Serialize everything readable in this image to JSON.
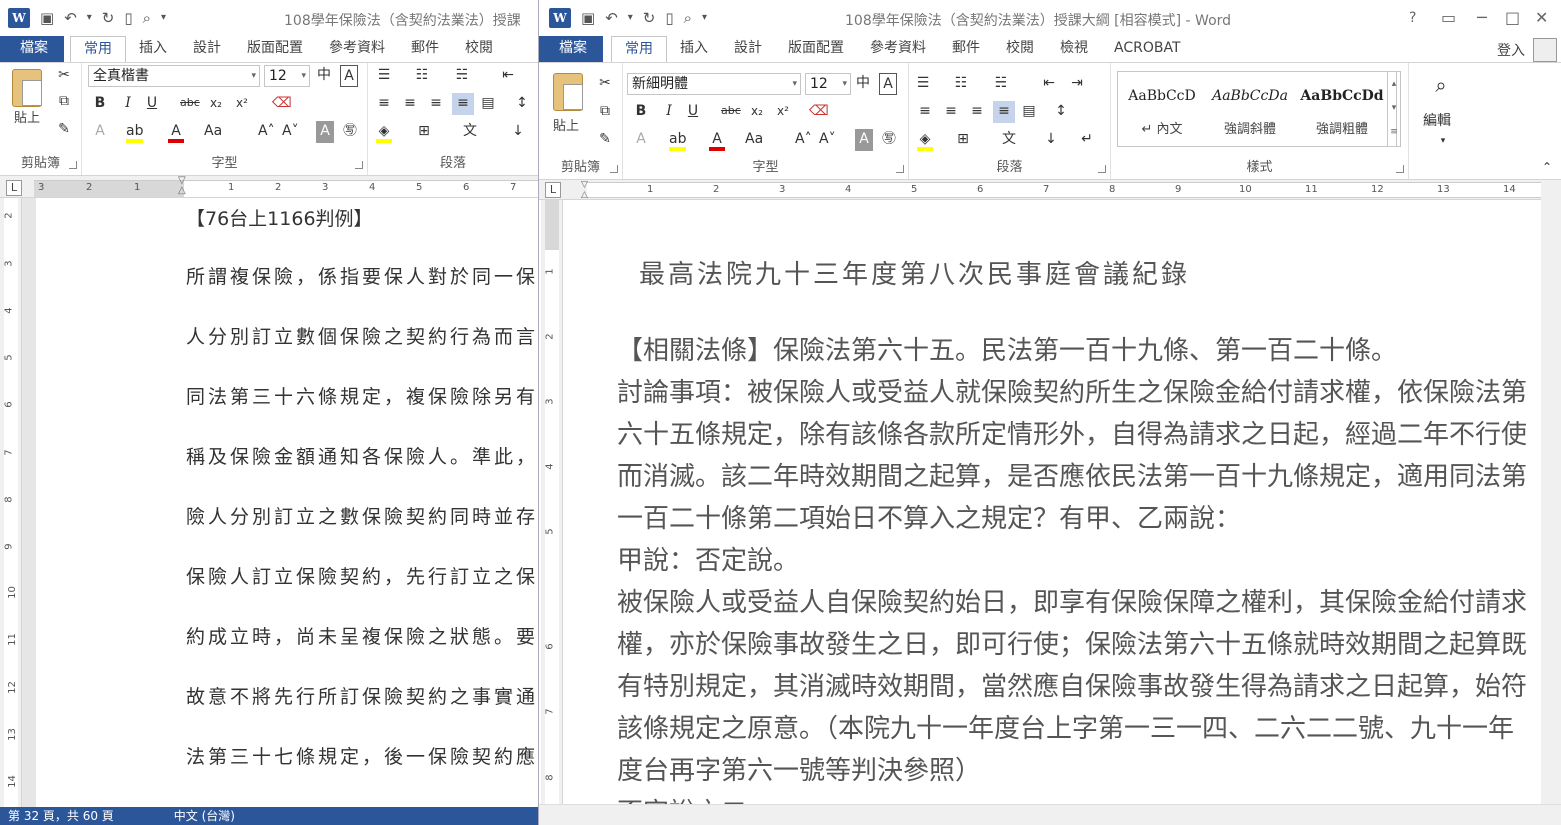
{
  "left_window": {
    "title": "108學年保險法（含契約法業法）授課",
    "tabs": [
      "檔案",
      "常用",
      "插入",
      "設計",
      "版面配置",
      "參考資料",
      "郵件",
      "校閱"
    ],
    "font_name": "全真楷書",
    "font_size": "12",
    "groups": [
      "剪貼簿",
      "字型",
      "段落"
    ],
    "paste_label": "貼上",
    "ruler_numbers": [
      "3",
      "2",
      "1",
      "1",
      "2",
      "3",
      "4",
      "5",
      "6",
      "7"
    ],
    "vruler_numbers": [
      "2",
      "3",
      "4",
      "5",
      "6",
      "7",
      "8",
      "9",
      "10",
      "11",
      "12",
      "13",
      "14"
    ],
    "heading": "【76台上1166判例】",
    "lines": [
      "所謂複保險，係指要保人對於同一保",
      "人分別訂立數個保險之契約行為而言",
      "同法第三十六條規定，複保險除另有",
      "稱及保險金額通知各保險人。準此，",
      "險人分別訂立之數保險契約同時並存",
      "保險人訂立保險契約，先行訂立之保",
      "約成立時，尚未呈複保險之狀態。要",
      "故意不將先行所訂保險契約之事實通",
      "法第三十七條規定，後一保險契約應"
    ],
    "status": "第 32 頁，共 60 頁　　　　　中文 (台灣)"
  },
  "right_window": {
    "title": "108學年保險法（含契約法業法）授課大綱 [相容模式] - Word",
    "help": "?",
    "tabs": [
      "檔案",
      "常用",
      "插入",
      "設計",
      "版面配置",
      "參考資料",
      "郵件",
      "校閱",
      "檢視",
      "ACROBAT"
    ],
    "login": "登入",
    "font_name": "新細明體",
    "font_size": "12",
    "groups": [
      "剪貼簿",
      "字型",
      "段落",
      "樣式"
    ],
    "paste_label": "貼上",
    "styles": [
      {
        "preview": "AaBbCcD",
        "name": "↵ 內文"
      },
      {
        "preview": "AaBbCcDa",
        "name": "強調斜體"
      },
      {
        "preview": "AaBbCcDd",
        "name": "強調粗體"
      }
    ],
    "edit_label": "編輯",
    "ruler_numbers": [
      "1",
      "2",
      "3",
      "4",
      "5",
      "6",
      "7",
      "8",
      "9",
      "10",
      "11",
      "12",
      "13",
      "14"
    ],
    "vruler_numbers": [
      "1",
      "2",
      "3",
      "4",
      "5",
      "6",
      "7",
      "8"
    ],
    "doc_title": "最高法院九十三年度第八次民事庭會議紀錄",
    "lines": [
      "【相關法條】保險法第六十五。民法第一百十九條、第一百二十條。",
      "討論事項：被保險人或受益人就保險契約所生之保險金給付請求權，依保險法第",
      "六十五條規定，除有該條各款所定情形外，自得為請求之日起，經過二年不行使",
      "而消滅。該二年時效期間之起算，是否應依民法第一百十九條規定，適用同法第",
      "一百二十條第二項始日不算入之規定？有甲、乙兩說：",
      "甲說：否定說。",
      "被保險人或受益人自保險契約始日，即享有保險保障之權利，其保險金給付請求",
      "權，亦於保險事故發生之日，即可行使；保險法第六十五條就時效期間之起算既",
      "有特別規定，其消滅時效期間，當然應自保險事故發生得為請求之日起算，始符",
      "該條規定之原意。（本院九十一年度台上字第一三一四、二六二二號、九十一年",
      "度台再字第六一號等判決參照）",
      "否定說之二"
    ]
  },
  "colors": {
    "word_blue": "#2b579a"
  }
}
